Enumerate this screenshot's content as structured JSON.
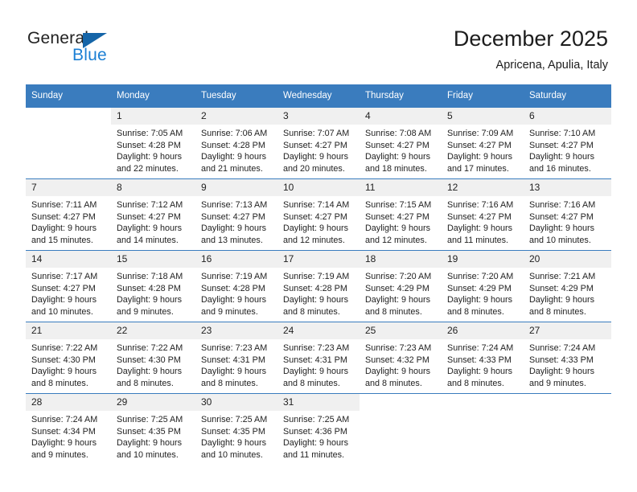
{
  "brand": {
    "name_part1": "General",
    "name_part2": "Blue",
    "triangle_color": "#1565a8",
    "blue_text_color": "#1b7fd4"
  },
  "header": {
    "title": "December 2025",
    "subtitle": "Apricena, Apulia, Italy"
  },
  "theme": {
    "header_row_bg": "#3a7cbe",
    "day_number_bg": "#f0f0f0",
    "grid_line": "#3a7cbe",
    "text": "#222222"
  },
  "weekdays": [
    "Sunday",
    "Monday",
    "Tuesday",
    "Wednesday",
    "Thursday",
    "Friday",
    "Saturday"
  ],
  "weeks": [
    [
      {
        "day": "",
        "sunrise": "",
        "sunset": "",
        "daylight_line1": "",
        "daylight_line2": ""
      },
      {
        "day": "1",
        "sunrise": "Sunrise: 7:05 AM",
        "sunset": "Sunset: 4:28 PM",
        "daylight_line1": "Daylight: 9 hours",
        "daylight_line2": "and 22 minutes."
      },
      {
        "day": "2",
        "sunrise": "Sunrise: 7:06 AM",
        "sunset": "Sunset: 4:28 PM",
        "daylight_line1": "Daylight: 9 hours",
        "daylight_line2": "and 21 minutes."
      },
      {
        "day": "3",
        "sunrise": "Sunrise: 7:07 AM",
        "sunset": "Sunset: 4:27 PM",
        "daylight_line1": "Daylight: 9 hours",
        "daylight_line2": "and 20 minutes."
      },
      {
        "day": "4",
        "sunrise": "Sunrise: 7:08 AM",
        "sunset": "Sunset: 4:27 PM",
        "daylight_line1": "Daylight: 9 hours",
        "daylight_line2": "and 18 minutes."
      },
      {
        "day": "5",
        "sunrise": "Sunrise: 7:09 AM",
        "sunset": "Sunset: 4:27 PM",
        "daylight_line1": "Daylight: 9 hours",
        "daylight_line2": "and 17 minutes."
      },
      {
        "day": "6",
        "sunrise": "Sunrise: 7:10 AM",
        "sunset": "Sunset: 4:27 PM",
        "daylight_line1": "Daylight: 9 hours",
        "daylight_line2": "and 16 minutes."
      }
    ],
    [
      {
        "day": "7",
        "sunrise": "Sunrise: 7:11 AM",
        "sunset": "Sunset: 4:27 PM",
        "daylight_line1": "Daylight: 9 hours",
        "daylight_line2": "and 15 minutes."
      },
      {
        "day": "8",
        "sunrise": "Sunrise: 7:12 AM",
        "sunset": "Sunset: 4:27 PM",
        "daylight_line1": "Daylight: 9 hours",
        "daylight_line2": "and 14 minutes."
      },
      {
        "day": "9",
        "sunrise": "Sunrise: 7:13 AM",
        "sunset": "Sunset: 4:27 PM",
        "daylight_line1": "Daylight: 9 hours",
        "daylight_line2": "and 13 minutes."
      },
      {
        "day": "10",
        "sunrise": "Sunrise: 7:14 AM",
        "sunset": "Sunset: 4:27 PM",
        "daylight_line1": "Daylight: 9 hours",
        "daylight_line2": "and 12 minutes."
      },
      {
        "day": "11",
        "sunrise": "Sunrise: 7:15 AM",
        "sunset": "Sunset: 4:27 PM",
        "daylight_line1": "Daylight: 9 hours",
        "daylight_line2": "and 12 minutes."
      },
      {
        "day": "12",
        "sunrise": "Sunrise: 7:16 AM",
        "sunset": "Sunset: 4:27 PM",
        "daylight_line1": "Daylight: 9 hours",
        "daylight_line2": "and 11 minutes."
      },
      {
        "day": "13",
        "sunrise": "Sunrise: 7:16 AM",
        "sunset": "Sunset: 4:27 PM",
        "daylight_line1": "Daylight: 9 hours",
        "daylight_line2": "and 10 minutes."
      }
    ],
    [
      {
        "day": "14",
        "sunrise": "Sunrise: 7:17 AM",
        "sunset": "Sunset: 4:27 PM",
        "daylight_line1": "Daylight: 9 hours",
        "daylight_line2": "and 10 minutes."
      },
      {
        "day": "15",
        "sunrise": "Sunrise: 7:18 AM",
        "sunset": "Sunset: 4:28 PM",
        "daylight_line1": "Daylight: 9 hours",
        "daylight_line2": "and 9 minutes."
      },
      {
        "day": "16",
        "sunrise": "Sunrise: 7:19 AM",
        "sunset": "Sunset: 4:28 PM",
        "daylight_line1": "Daylight: 9 hours",
        "daylight_line2": "and 9 minutes."
      },
      {
        "day": "17",
        "sunrise": "Sunrise: 7:19 AM",
        "sunset": "Sunset: 4:28 PM",
        "daylight_line1": "Daylight: 9 hours",
        "daylight_line2": "and 8 minutes."
      },
      {
        "day": "18",
        "sunrise": "Sunrise: 7:20 AM",
        "sunset": "Sunset: 4:29 PM",
        "daylight_line1": "Daylight: 9 hours",
        "daylight_line2": "and 8 minutes."
      },
      {
        "day": "19",
        "sunrise": "Sunrise: 7:20 AM",
        "sunset": "Sunset: 4:29 PM",
        "daylight_line1": "Daylight: 9 hours",
        "daylight_line2": "and 8 minutes."
      },
      {
        "day": "20",
        "sunrise": "Sunrise: 7:21 AM",
        "sunset": "Sunset: 4:29 PM",
        "daylight_line1": "Daylight: 9 hours",
        "daylight_line2": "and 8 minutes."
      }
    ],
    [
      {
        "day": "21",
        "sunrise": "Sunrise: 7:22 AM",
        "sunset": "Sunset: 4:30 PM",
        "daylight_line1": "Daylight: 9 hours",
        "daylight_line2": "and 8 minutes."
      },
      {
        "day": "22",
        "sunrise": "Sunrise: 7:22 AM",
        "sunset": "Sunset: 4:30 PM",
        "daylight_line1": "Daylight: 9 hours",
        "daylight_line2": "and 8 minutes."
      },
      {
        "day": "23",
        "sunrise": "Sunrise: 7:23 AM",
        "sunset": "Sunset: 4:31 PM",
        "daylight_line1": "Daylight: 9 hours",
        "daylight_line2": "and 8 minutes."
      },
      {
        "day": "24",
        "sunrise": "Sunrise: 7:23 AM",
        "sunset": "Sunset: 4:31 PM",
        "daylight_line1": "Daylight: 9 hours",
        "daylight_line2": "and 8 minutes."
      },
      {
        "day": "25",
        "sunrise": "Sunrise: 7:23 AM",
        "sunset": "Sunset: 4:32 PM",
        "daylight_line1": "Daylight: 9 hours",
        "daylight_line2": "and 8 minutes."
      },
      {
        "day": "26",
        "sunrise": "Sunrise: 7:24 AM",
        "sunset": "Sunset: 4:33 PM",
        "daylight_line1": "Daylight: 9 hours",
        "daylight_line2": "and 8 minutes."
      },
      {
        "day": "27",
        "sunrise": "Sunrise: 7:24 AM",
        "sunset": "Sunset: 4:33 PM",
        "daylight_line1": "Daylight: 9 hours",
        "daylight_line2": "and 9 minutes."
      }
    ],
    [
      {
        "day": "28",
        "sunrise": "Sunrise: 7:24 AM",
        "sunset": "Sunset: 4:34 PM",
        "daylight_line1": "Daylight: 9 hours",
        "daylight_line2": "and 9 minutes."
      },
      {
        "day": "29",
        "sunrise": "Sunrise: 7:25 AM",
        "sunset": "Sunset: 4:35 PM",
        "daylight_line1": "Daylight: 9 hours",
        "daylight_line2": "and 10 minutes."
      },
      {
        "day": "30",
        "sunrise": "Sunrise: 7:25 AM",
        "sunset": "Sunset: 4:35 PM",
        "daylight_line1": "Daylight: 9 hours",
        "daylight_line2": "and 10 minutes."
      },
      {
        "day": "31",
        "sunrise": "Sunrise: 7:25 AM",
        "sunset": "Sunset: 4:36 PM",
        "daylight_line1": "Daylight: 9 hours",
        "daylight_line2": "and 11 minutes."
      },
      {
        "day": "",
        "sunrise": "",
        "sunset": "",
        "daylight_line1": "",
        "daylight_line2": ""
      },
      {
        "day": "",
        "sunrise": "",
        "sunset": "",
        "daylight_line1": "",
        "daylight_line2": ""
      },
      {
        "day": "",
        "sunrise": "",
        "sunset": "",
        "daylight_line1": "",
        "daylight_line2": ""
      }
    ]
  ]
}
